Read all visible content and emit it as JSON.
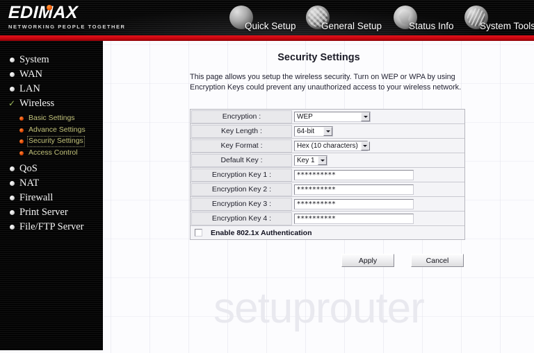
{
  "brand": {
    "name": "EDIMAX",
    "tagline": "NETWORKING PEOPLE TOGETHER",
    "accent_red": "#c8060e",
    "accent_orange": "#f25c05"
  },
  "nav": {
    "items": [
      {
        "label": "Quick Setup",
        "icon": "sphere-mouse-icon"
      },
      {
        "label": "General Setup",
        "icon": "sphere-grid-icon"
      },
      {
        "label": "Status Info",
        "icon": "sphere-star-icon"
      },
      {
        "label": "System Tools",
        "icon": "sphere-tools-icon"
      }
    ]
  },
  "sidebar": {
    "items": [
      {
        "label": "System",
        "marker": "bullet"
      },
      {
        "label": "WAN",
        "marker": "bullet"
      },
      {
        "label": "LAN",
        "marker": "bullet"
      },
      {
        "label": "Wireless",
        "marker": "check"
      }
    ],
    "sub_items": [
      {
        "label": "Basic Settings",
        "selected": false
      },
      {
        "label": "Advance Settings",
        "selected": false
      },
      {
        "label": "Security Settings",
        "selected": true
      },
      {
        "label": "Access Control",
        "selected": false
      }
    ],
    "items_after": [
      {
        "label": "QoS",
        "marker": "bullet"
      },
      {
        "label": "NAT",
        "marker": "bullet"
      },
      {
        "label": "Firewall",
        "marker": "bullet"
      },
      {
        "label": "Print Server",
        "marker": "bullet"
      },
      {
        "label": "File/FTP Server",
        "marker": "bullet"
      }
    ]
  },
  "main": {
    "title": "Security Settings",
    "description": "This page allows you setup the wireless security. Turn on WEP or WPA by using Encryption Keys could prevent any unauthorized access to your wireless network.",
    "fields": [
      {
        "label": "Encryption :",
        "type": "select",
        "value": "WEP"
      },
      {
        "label": "Key Length :",
        "type": "select",
        "value": "64-bit"
      },
      {
        "label": "Key Format :",
        "type": "select",
        "value": "Hex (10 characters)"
      },
      {
        "label": "Default Key :",
        "type": "select",
        "value": "Key 1"
      },
      {
        "label": "Encryption Key 1 :",
        "type": "password",
        "value": "**********"
      },
      {
        "label": "Encryption Key 2 :",
        "type": "password",
        "value": "**********"
      },
      {
        "label": "Encryption Key 3 :",
        "type": "password",
        "value": "**********"
      },
      {
        "label": "Encryption Key 4 :",
        "type": "password",
        "value": "**********"
      }
    ],
    "checkbox": {
      "label": "Enable 802.1x Authentication",
      "checked": false
    },
    "buttons": {
      "apply": "Apply",
      "cancel": "Cancel"
    }
  },
  "watermark": "setuprouter"
}
